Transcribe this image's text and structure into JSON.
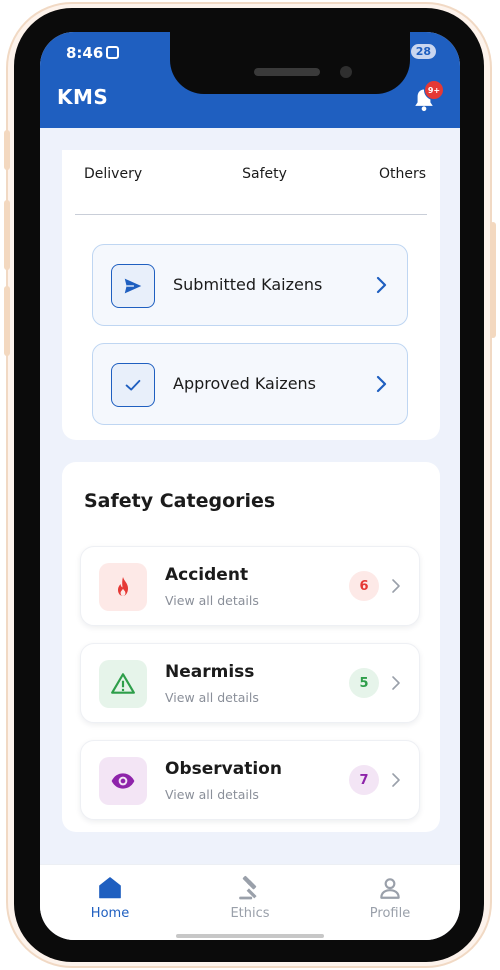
{
  "status_bar": {
    "time": "8:46",
    "battery": "28"
  },
  "app_bar": {
    "title": "KMS",
    "notification_badge": "9+"
  },
  "kaizen_section": {
    "tabs": [
      "Delivery",
      "Safety",
      "Others"
    ],
    "buttons": [
      {
        "label": "Submitted Kaizens",
        "icon": "send-icon"
      },
      {
        "label": "Approved Kaizens",
        "icon": "check-icon"
      }
    ]
  },
  "safety_categories": {
    "title": "Safety Categories",
    "items": [
      {
        "name": "Accident",
        "subtitle": "View all details",
        "count": "6",
        "icon": "fire-icon",
        "color": "#e53935",
        "bg": "#fde9e7",
        "count_bg": "#fde9e7"
      },
      {
        "name": "Nearmiss",
        "subtitle": "View all details",
        "count": "5",
        "icon": "warning-icon",
        "color": "#2e9e4a",
        "bg": "#e6f4ea",
        "count_bg": "#e6f4ea"
      },
      {
        "name": "Observation",
        "subtitle": "View all details",
        "count": "7",
        "icon": "eye-icon",
        "color": "#8e24aa",
        "bg": "#f3e5f5",
        "count_bg": "#f3e5f5"
      }
    ]
  },
  "bottom_nav": {
    "items": [
      {
        "label": "Home",
        "icon": "home-icon",
        "active": true
      },
      {
        "label": "Ethics",
        "icon": "gavel-icon",
        "active": false
      },
      {
        "label": "Profile",
        "icon": "person-icon",
        "active": false
      }
    ]
  },
  "colors": {
    "primary": "#1f5fc0",
    "inactive": "#9aa0aa"
  }
}
